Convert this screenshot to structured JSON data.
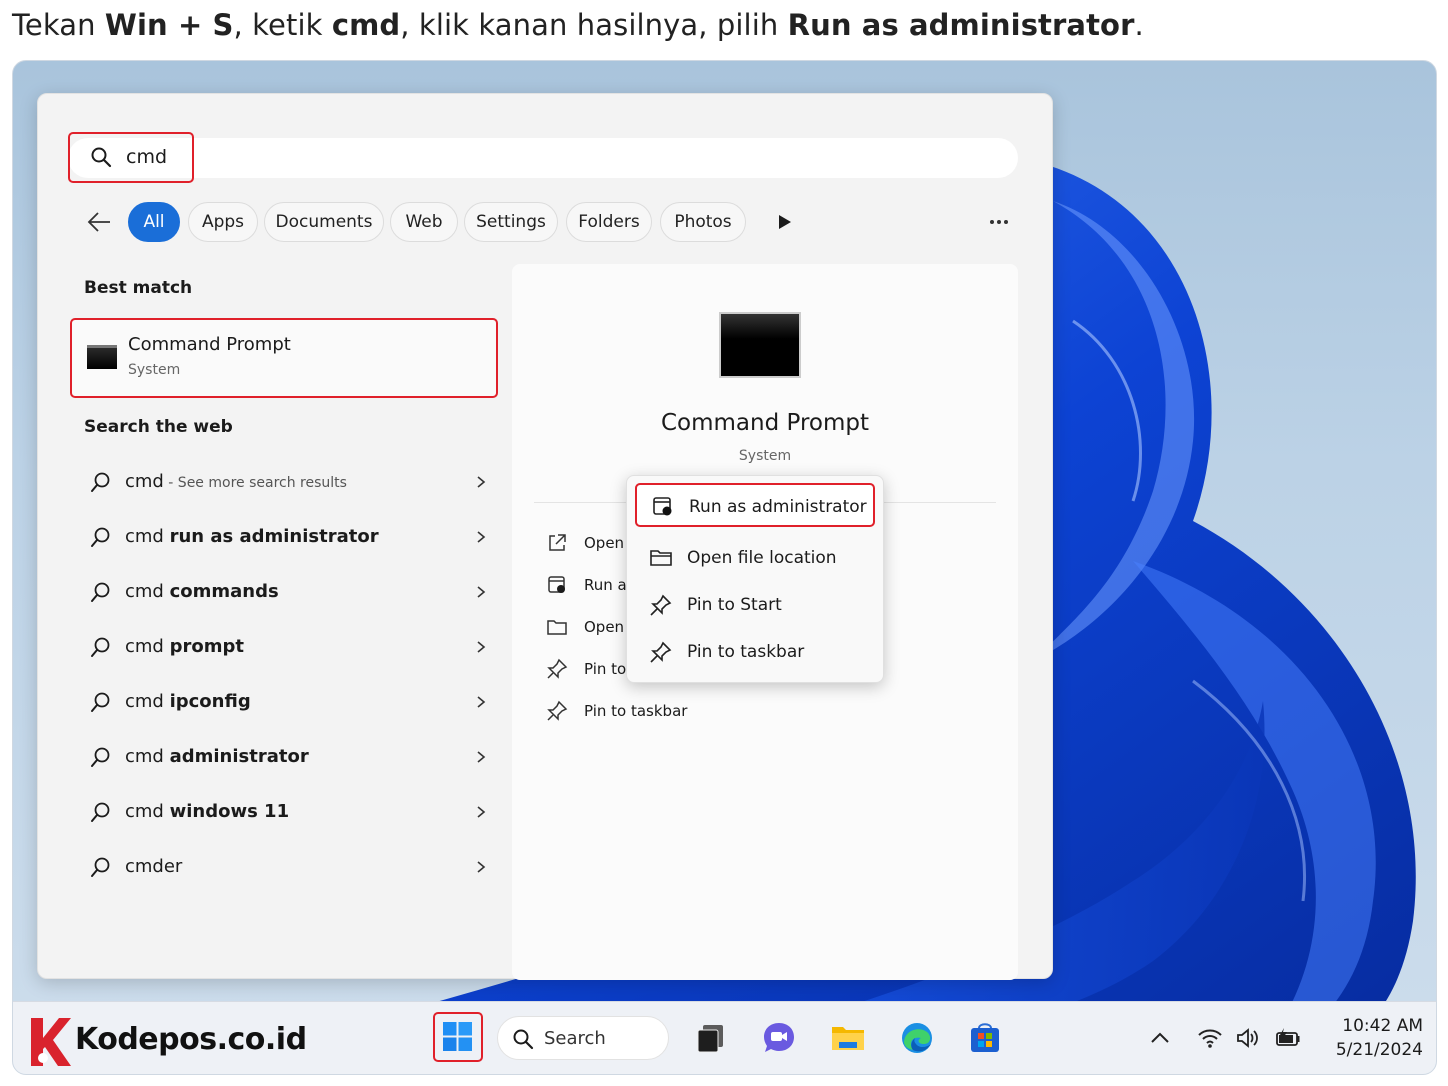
{
  "instruction": {
    "p1": "Tekan ",
    "b1": "Win + S",
    "p2": ", ketik ",
    "b2": "cmd",
    "p3": ", klik kanan hasilnya, pilih ",
    "b3": "Run as administrator",
    "p4": "."
  },
  "search": {
    "value": "cmd"
  },
  "filters": [
    "All",
    "Apps",
    "Documents",
    "Web",
    "Settings",
    "Folders",
    "Photos"
  ],
  "best_match": {
    "title": "Best match",
    "name": "Command Prompt",
    "type": "System"
  },
  "web": {
    "title": "Search the web",
    "items": [
      {
        "prefix": "cmd",
        "bold": "",
        "hint": " - See more search results"
      },
      {
        "prefix": "cmd ",
        "bold": "run as administrator",
        "hint": ""
      },
      {
        "prefix": "cmd ",
        "bold": "commands",
        "hint": ""
      },
      {
        "prefix": "cmd ",
        "bold": "prompt",
        "hint": ""
      },
      {
        "prefix": "cmd ",
        "bold": "ipconfig",
        "hint": ""
      },
      {
        "prefix": "cmd ",
        "bold": "administrator",
        "hint": ""
      },
      {
        "prefix": "cmd ",
        "bold": "windows 11",
        "hint": ""
      },
      {
        "prefix": "cmder",
        "bold": "",
        "hint": ""
      }
    ]
  },
  "preview": {
    "name": "Command Prompt",
    "type": "System",
    "actions": [
      "Open",
      "Run as",
      "Open",
      "Pin to",
      "Pin to taskbar"
    ]
  },
  "context_menu": {
    "items": [
      "Run as administrator",
      "Open file location",
      "Pin to Start",
      "Pin to taskbar"
    ]
  },
  "taskbar": {
    "logo": "Kodepos.co.id",
    "search_label": "Search",
    "time": "10:42 AM",
    "date": "5/21/2024"
  },
  "colors": {
    "highlight": "#e0202a",
    "accent": "#1a6ed8",
    "bloom": "#1a5ee0"
  }
}
